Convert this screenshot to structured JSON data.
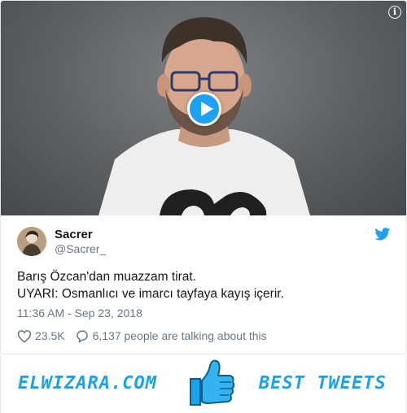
{
  "tweet": {
    "author_name": "Sacrer",
    "author_handle": "@Sacrer_",
    "text_line1": "Barış Özcan'dan muazzam tirat.",
    "text_line2": "UYARI: Osmanlıcı ve imarcı tayfaya kayış içerir.",
    "timestamp": "11:36 AM - Sep 23, 2018",
    "like_count": "23.5K",
    "talking_text": "6,137 people are talking about this"
  },
  "media": {
    "type": "video",
    "info_icon": "info-icon",
    "play_icon": "play-icon"
  },
  "banner": {
    "site_name": "ELWIZARA.COM",
    "tagline": "BEST TWEETS",
    "icon": "thumbs-up-icon"
  },
  "colors": {
    "accent": "#1da1f2",
    "banner_text": "#1aa3ea",
    "secondary_text": "#657786",
    "primary_text": "#14171a"
  }
}
